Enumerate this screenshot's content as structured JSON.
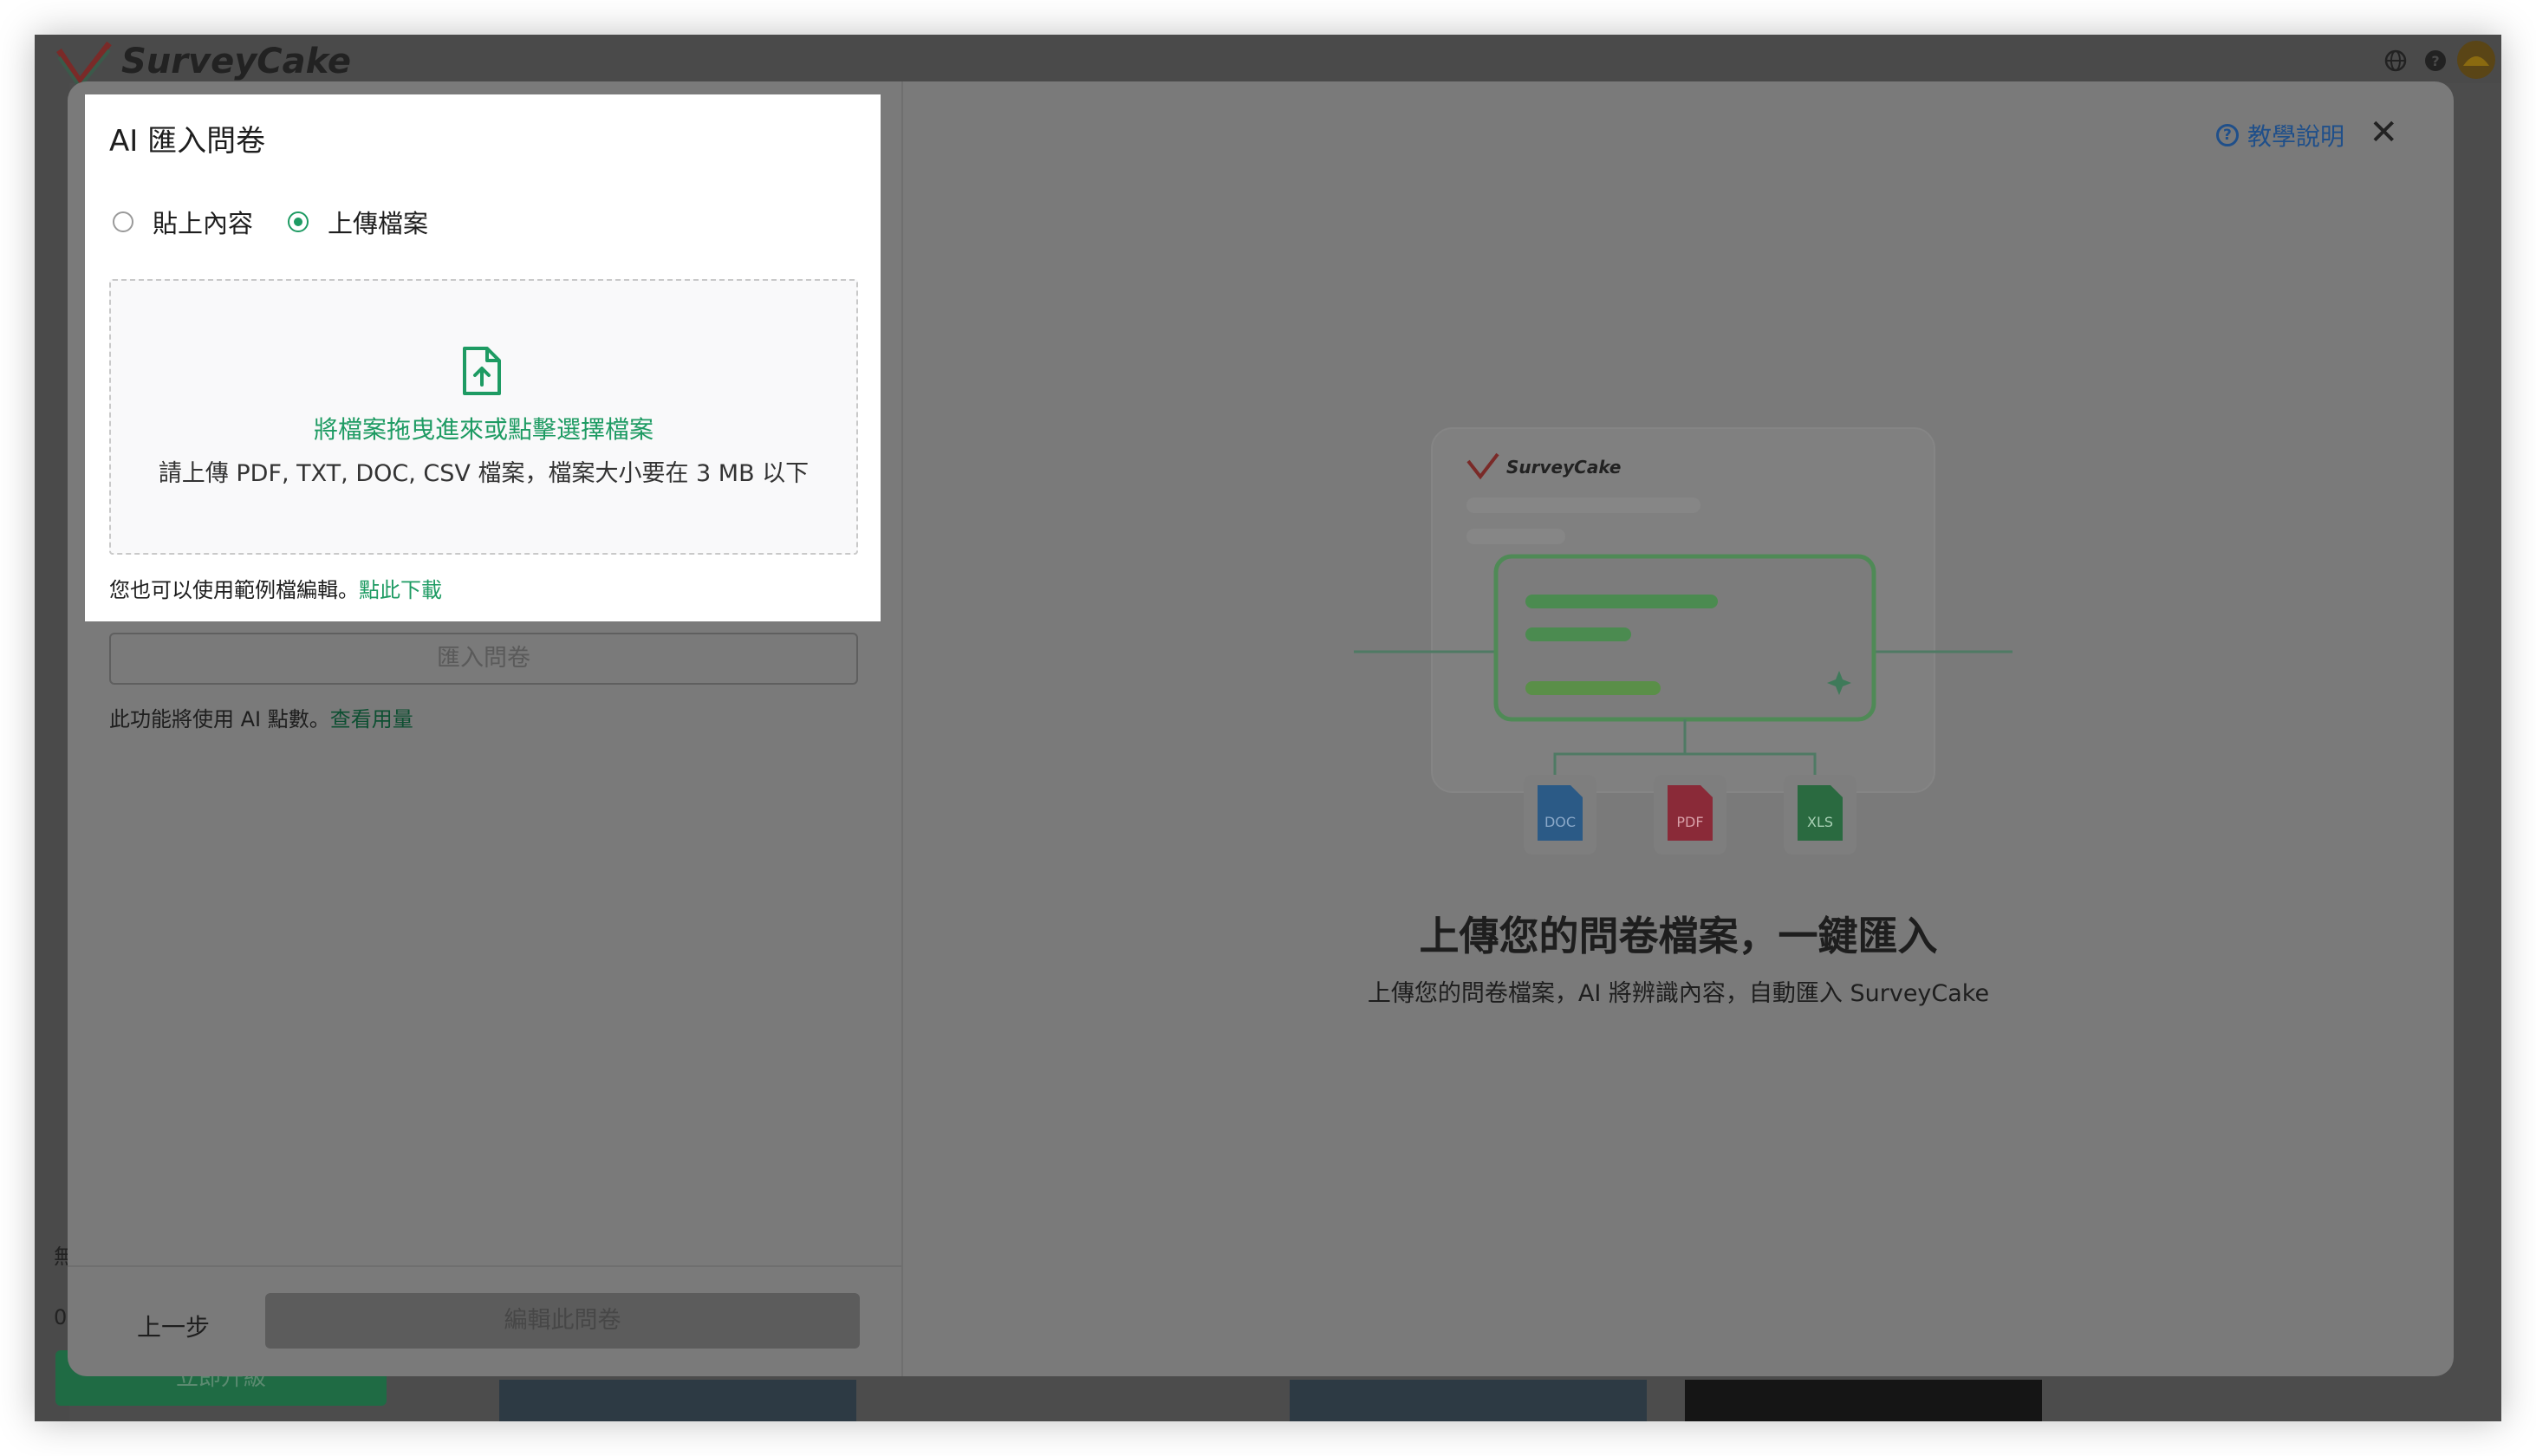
{
  "app": {
    "logo_text": "SurveyCake",
    "icons": [
      "globe-icon",
      "help-circle-icon",
      "avatar"
    ],
    "bg_side_texts": [
      "無",
      "0"
    ],
    "bg_button_label": "立即升級"
  },
  "modal": {
    "help_link_label": "教學說明",
    "close_icon": "close-icon"
  },
  "popup": {
    "title": "AI 匯入問卷",
    "radio_options": [
      {
        "label": "貼上內容",
        "selected": false
      },
      {
        "label": "上傳檔案",
        "selected": true
      }
    ],
    "dropzone": {
      "icon": "file-upload-icon",
      "main_text": "將檔案拖曳進來或點擊選擇檔案",
      "sub_text": "請上傳 PDF, TXT, DOC, CSV 檔案，檔案大小要在 3 MB 以下"
    },
    "sample_note": "您也可以使用範例檔編輯。",
    "sample_link": "點此下載"
  },
  "left_pane": {
    "import_button": "匯入問卷",
    "ai_note": "此功能將使用 AI 點數。",
    "ai_note_link": "查看用量",
    "prev_button": "上一步",
    "edit_button": "編輯此問卷"
  },
  "illustration": {
    "brand": "SurveyCake",
    "file_types": [
      "DOC",
      "PDF",
      "XLS"
    ],
    "colors": {
      "doc": "#3f82c8",
      "pdf": "#c8354a",
      "xls": "#3a9a5b",
      "accent": "#1e9b63"
    }
  },
  "hero": {
    "title": "上傳您的問卷檔案，一鍵匯入",
    "subtitle": "上傳您的問卷檔案，AI 將辨識內容，自動匯入 SurveyCake"
  }
}
